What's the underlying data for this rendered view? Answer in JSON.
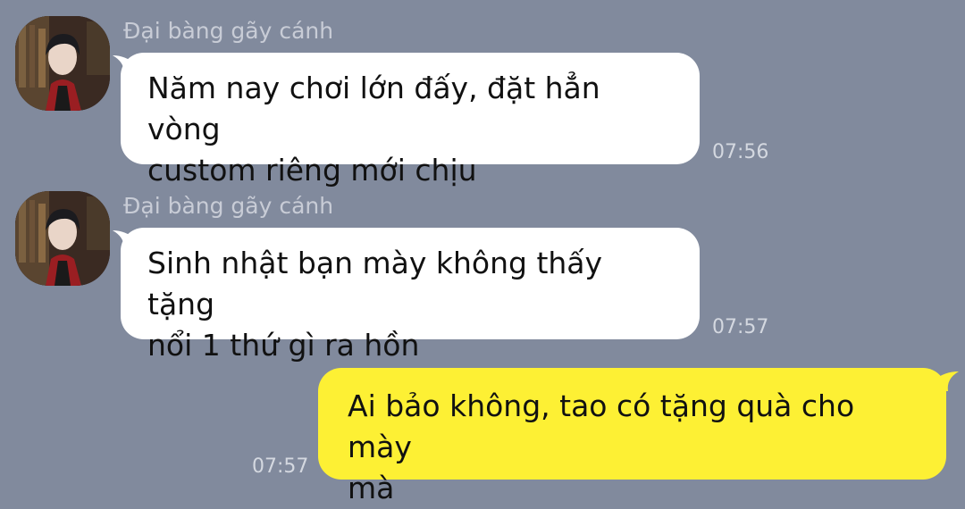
{
  "messages": [
    {
      "direction": "incoming",
      "sender": "Đại bàng gãy cánh",
      "lines": [
        "Năm nay chơi lớn đấy, đặt hẳn vòng",
        "custom riêng mới chịu"
      ],
      "time": "07:56"
    },
    {
      "direction": "incoming",
      "sender": "Đại bàng gãy cánh",
      "lines": [
        "Sinh nhật bạn mày không thấy tặng",
        "nổi 1 thứ gì ra hồn"
      ],
      "time": "07:57"
    },
    {
      "direction": "outgoing",
      "lines": [
        "Ai bảo không, tao có tặng quà cho mày",
        "mà"
      ],
      "time": "07:57"
    }
  ],
  "colors": {
    "background": "#818a9d",
    "incoming_bubble": "#ffffff",
    "outgoing_bubble": "#fdf034"
  },
  "icons": {
    "avatar": "user-photo-avatar"
  }
}
